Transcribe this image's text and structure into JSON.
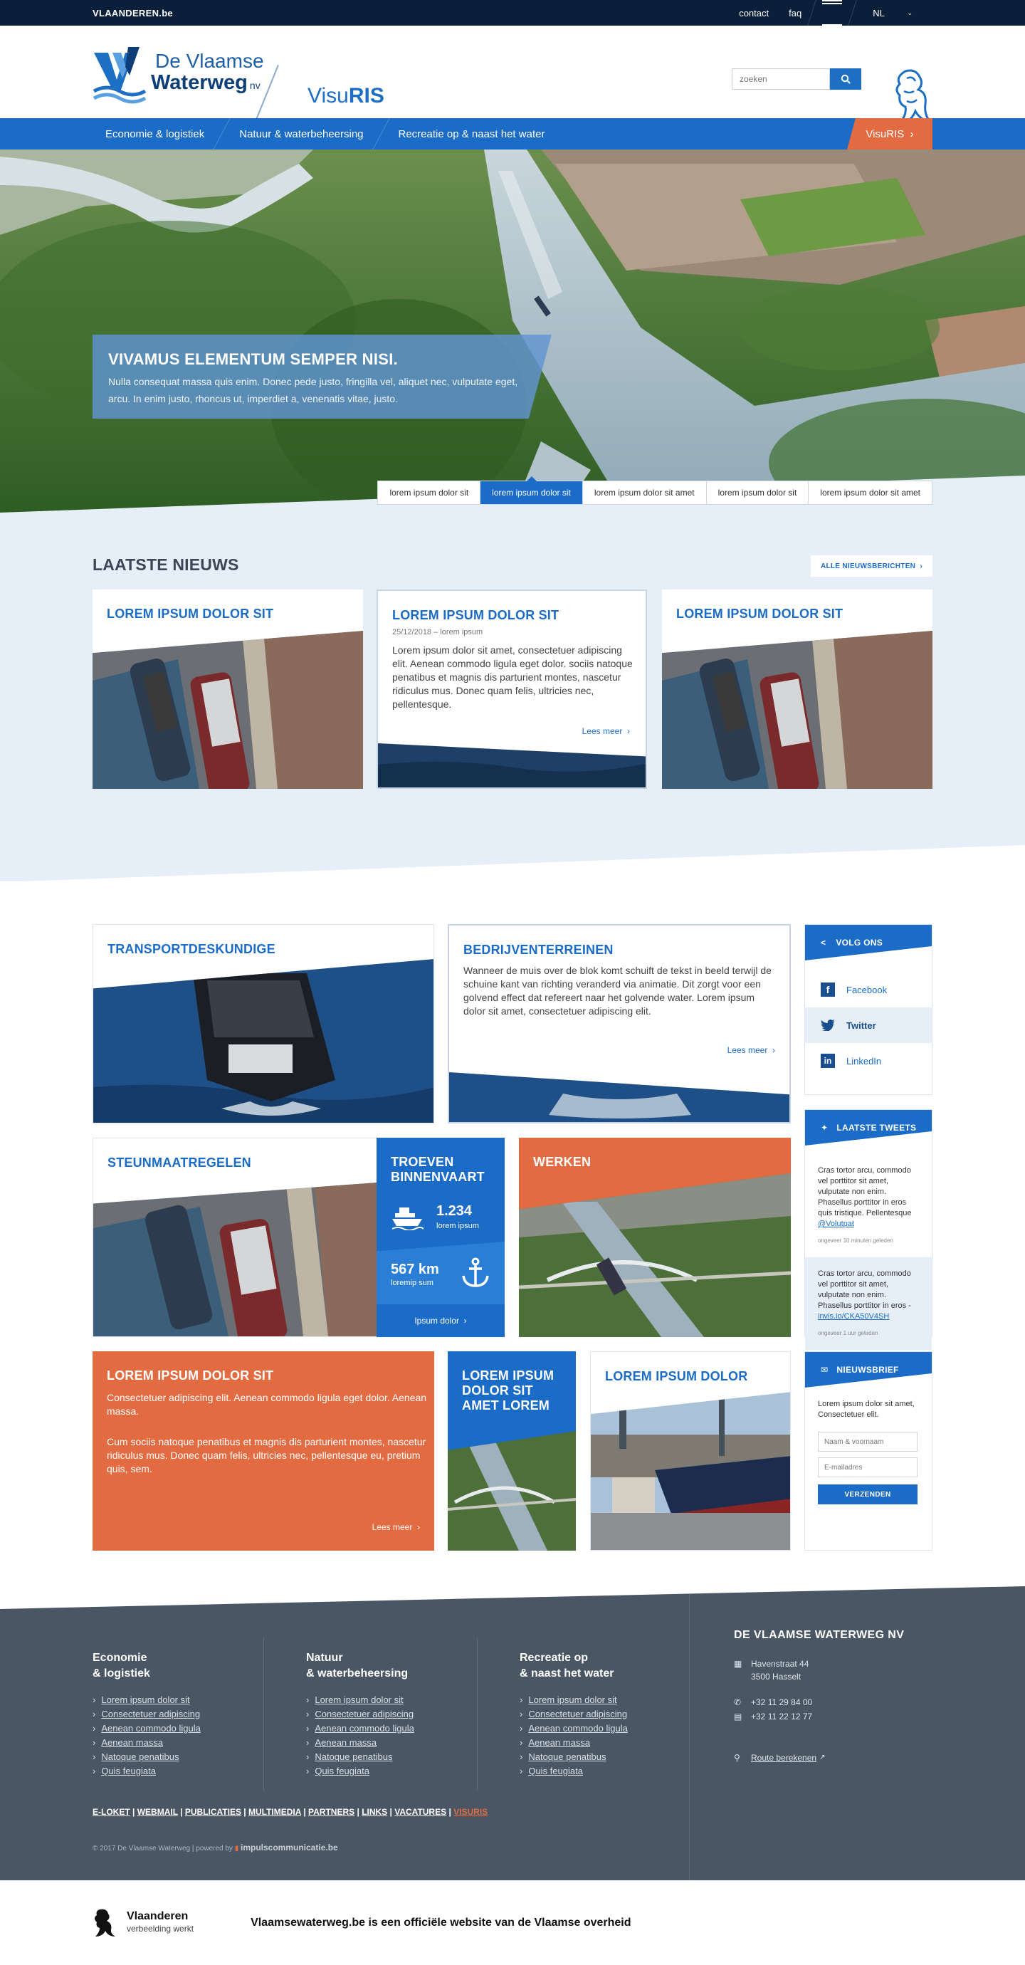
{
  "topbar": {
    "brand": "VLAANDEREN.be",
    "contact": "contact",
    "faq": "faq",
    "lang": "NL"
  },
  "header": {
    "logo_line1": "De Vlaamse",
    "logo_line2": "Waterweg",
    "logo_nv": "nv",
    "app_name_a": "Visu",
    "app_name_b": "RIS",
    "search_placeholder": "zoeken"
  },
  "nav": {
    "items": [
      "Economie & logistiek",
      "Natuur & waterbeheersing",
      "Recreatie op & naast het water"
    ],
    "cta": "VisuRIS"
  },
  "hero": {
    "title": "VIVAMUS ELEMENTUM SEMPER NISI.",
    "text": "Nulla consequat massa quis enim. Donec pede justo, fringilla vel, aliquet nec, vulputate eget, arcu. In enim justo, rhoncus ut, imperdiet a, venenatis vitae, justo.",
    "slides": [
      "lorem ipsum dolor sit",
      "lorem ipsum dolor sit",
      "lorem ipsum dolor sit amet",
      "lorem ipsum dolor sit",
      "lorem ipsum dolor sit amet"
    ]
  },
  "news": {
    "title": "LAATSTE NIEUWS",
    "all": "ALLE NIEUWSBERICHTEN",
    "cards": [
      {
        "title": "LOREM IPSUM DOLOR SIT"
      },
      {
        "title": "LOREM IPSUM DOLOR SIT",
        "meta": "25/12/2018 – lorem ipsum",
        "text": "Lorem ipsum dolor sit amet, consectetuer adipiscing elit. Aenean commodo ligula eget dolor. sociis natoque penatibus et magnis dis parturient montes, nascetur ridiculus mus. Donec quam felis, ultricies nec, pellentesque.",
        "more": "Lees meer"
      },
      {
        "title": "LOREM IPSUM DOLOR SIT"
      }
    ]
  },
  "tiles": {
    "transport": {
      "title": "TRANSPORTDESKUNDIGE"
    },
    "bedrijven": {
      "title": "BEDRIJVENTERREINEN",
      "text": "Wanneer de muis over de blok komt schuift de tekst in beeld terwijl de schuine kant van richting veranderd via animatie. Dit zorgt voor een golvend effect dat refereert naar het golvende water. Lorem ipsum dolor sit amet, consectetuer adipiscing elit.",
      "more": "Lees meer"
    },
    "steun": {
      "title": "STEUNMAATREGELEN"
    },
    "troeven": {
      "title": "TROEVEN BINNENVAART",
      "stat1": "1.234",
      "stat1_label": "lorem ipsum",
      "stat2": "567 km",
      "stat2_label": "loremip sum",
      "more": "Ipsum dolor"
    },
    "werken": {
      "title": "WERKEN"
    },
    "lorem1": {
      "title": "LOREM IPSUM DOLOR SIT",
      "p1": "Consectetuer adipiscing elit. Aenean commodo ligula eget dolor. Aenean massa.",
      "p2": "Cum sociis natoque penatibus et magnis dis parturient montes, nascetur ridiculus mus. Donec quam felis, ultricies nec, pellentesque eu, pretium quis, sem.",
      "more": "Lees meer"
    },
    "lorem2": {
      "title": "LOREM IPSUM DOLOR SIT AMET LOREM"
    },
    "lorem3": {
      "title": "LOREM IPSUM DOLOR"
    }
  },
  "sidebar": {
    "follow": {
      "title": "VOLG ONS",
      "items": [
        "Facebook",
        "Twitter",
        "LinkedIn"
      ]
    },
    "tweets": {
      "title": "LAATSTE TWEETS",
      "items": [
        {
          "text": "Cras tortor arcu, commodo vel porttitor sit amet, vulputate non enim. Phasellus porttitor in eros quis tristique. Pellentesque",
          "link": "@Volutpat",
          "ago": "ongeveer 10 minuten geleden"
        },
        {
          "text": "Cras tortor arcu, commodo vel porttitor sit amet, vulputate non enim. Phasellus porttitor in eros -",
          "link": "invis.io/CKA50V4SH",
          "ago": "ongeveer 1 uur geleden"
        }
      ]
    },
    "newsletter": {
      "title": "NIEUWSBRIEF",
      "text": "Lorem ipsum dolor sit amet, Consectetuer elit.",
      "name_ph": "Naam & voornaam",
      "email_ph": "E-mailadres",
      "submit": "VERZENDEN"
    }
  },
  "footer": {
    "cols": [
      {
        "title1": "Economie",
        "title2": "& logistiek",
        "links": [
          "Lorem ipsum dolor sit",
          "Consectetuer adipiscing",
          "Aenean commodo ligula",
          "Aenean massa",
          "Natoque penatibus",
          "Quis feugiata"
        ]
      },
      {
        "title1": "Natuur",
        "title2": "& waterbeheersing",
        "links": [
          "Lorem ipsum dolor sit",
          "Consectetuer adipiscing",
          "Aenean commodo ligula",
          "Aenean massa",
          "Natoque penatibus",
          "Quis feugiata"
        ]
      },
      {
        "title1": "Recreatie op",
        "title2": "& naast het water",
        "links": [
          "Lorem ipsum dolor sit",
          "Consectetuer adipiscing",
          "Aenean commodo ligula",
          "Aenean massa",
          "Natoque penatibus",
          "Quis feugiata"
        ]
      }
    ],
    "org": "DE VLAAMSE WATERWEG NV",
    "street": "Havenstraat 44",
    "city": "3500 Hasselt",
    "phone": "+32 11 29 84 00",
    "fax": "+32 11 22 12 77",
    "route": "Route berekenen",
    "links": [
      "E-LOKET",
      "WEBMAIL",
      "PUBLICATIES",
      "MULTIMEDIA",
      "PARTNERS",
      "LINKS",
      "VACATURES",
      "VISURIS"
    ],
    "copy": "© 2017 De Vlaamse Waterweg | powered by",
    "agency": "impulscommunicatie.be"
  },
  "bottom": {
    "brand": "Vlaanderen",
    "tagline": "verbeelding werkt",
    "official": "Vlaamsewaterweg.be is een officiële website van de Vlaamse overheid"
  }
}
